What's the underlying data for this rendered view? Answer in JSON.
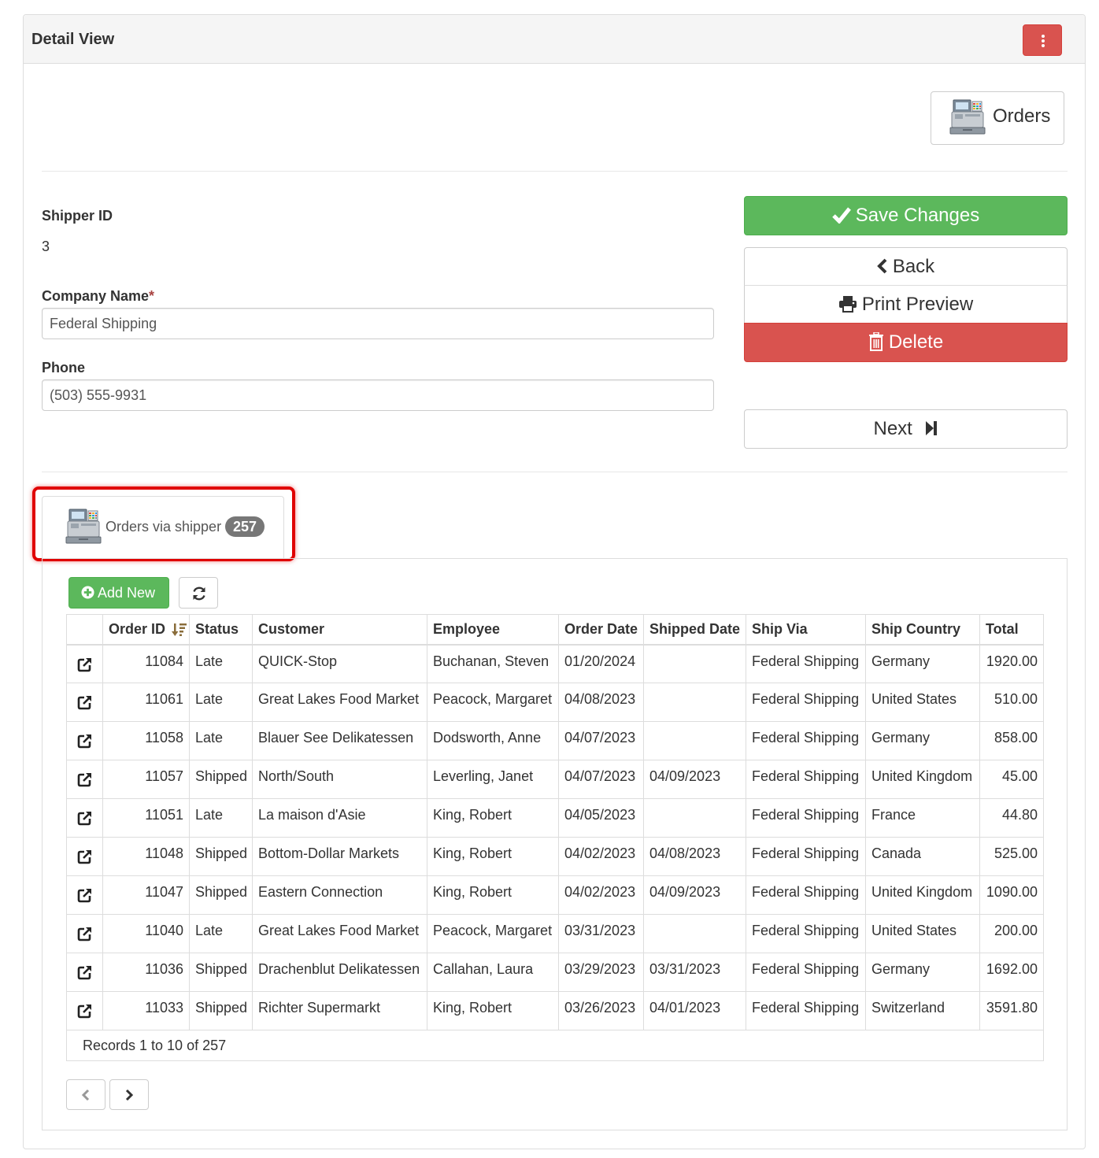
{
  "header": {
    "title": "Detail View",
    "menu_icon": "kebab-vertical-icon"
  },
  "orders_link": {
    "label": "Orders",
    "icon": "cash-register-icon"
  },
  "form": {
    "shipper_id": {
      "label": "Shipper ID",
      "value": "3"
    },
    "company_name": {
      "label": "Company Name",
      "required_mark": "*",
      "value": "Federal Shipping"
    },
    "phone": {
      "label": "Phone",
      "value": "(503) 555-9931"
    }
  },
  "actions": {
    "save": "Save Changes",
    "back": "Back",
    "print": "Print Preview",
    "delete": "Delete",
    "next": "Next"
  },
  "colors": {
    "success": "#5cb85c",
    "danger": "#d9534f",
    "highlight": "#e00000",
    "badge": "#777777"
  },
  "tab": {
    "label": "Orders via shipper",
    "count": "257",
    "icon": "cash-register-icon"
  },
  "toolbar": {
    "add_new": "Add New",
    "refresh_icon": "refresh-icon"
  },
  "table": {
    "sort_icon": "sort-desc-icon",
    "columns": [
      "Order ID",
      "Status",
      "Customer",
      "Employee",
      "Order Date",
      "Shipped Date",
      "Ship Via",
      "Ship Country",
      "Total"
    ],
    "rows": [
      [
        "11084",
        "Late",
        "QUICK-Stop",
        "Buchanan, Steven",
        "01/20/2024",
        "",
        "Federal Shipping",
        "Germany",
        "1920.00"
      ],
      [
        "11061",
        "Late",
        "Great Lakes Food Market",
        "Peacock, Margaret",
        "04/08/2023",
        "",
        "Federal Shipping",
        "United States",
        "510.00"
      ],
      [
        "11058",
        "Late",
        "Blauer See Delikatessen",
        "Dodsworth, Anne",
        "04/07/2023",
        "",
        "Federal Shipping",
        "Germany",
        "858.00"
      ],
      [
        "11057",
        "Shipped",
        "North/South",
        "Leverling, Janet",
        "04/07/2023",
        "04/09/2023",
        "Federal Shipping",
        "United Kingdom",
        "45.00"
      ],
      [
        "11051",
        "Late",
        "La maison d'Asie",
        "King, Robert",
        "04/05/2023",
        "",
        "Federal Shipping",
        "France",
        "44.80"
      ],
      [
        "11048",
        "Shipped",
        "Bottom-Dollar Markets",
        "King, Robert",
        "04/02/2023",
        "04/08/2023",
        "Federal Shipping",
        "Canada",
        "525.00"
      ],
      [
        "11047",
        "Shipped",
        "Eastern Connection",
        "King, Robert",
        "04/02/2023",
        "04/09/2023",
        "Federal Shipping",
        "United Kingdom",
        "1090.00"
      ],
      [
        "11040",
        "Late",
        "Great Lakes Food Market",
        "Peacock, Margaret",
        "03/31/2023",
        "",
        "Federal Shipping",
        "United States",
        "200.00"
      ],
      [
        "11036",
        "Shipped",
        "Drachenblut Delikatessen",
        "Callahan, Laura",
        "03/29/2023",
        "03/31/2023",
        "Federal Shipping",
        "Germany",
        "1692.00"
      ],
      [
        "11033",
        "Shipped",
        "Richter Supermarkt",
        "King, Robert",
        "03/26/2023",
        "04/01/2023",
        "Federal Shipping",
        "Switzerland",
        "3591.80"
      ]
    ],
    "footer": "Records 1 to 10 of 257"
  },
  "pager": {
    "prev_icon": "chevron-left-icon",
    "next_icon": "chevron-right-icon"
  }
}
